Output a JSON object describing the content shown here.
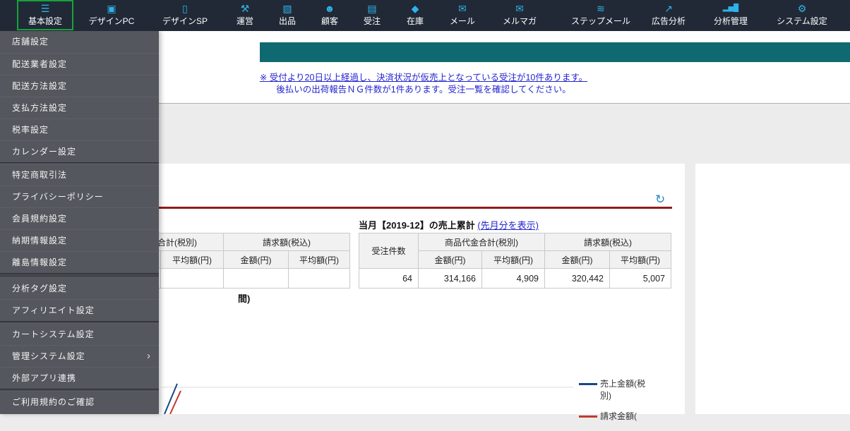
{
  "colors": {
    "nav_bg": "#212937",
    "nav_icon": "#2fb3e8",
    "menu_bg": "#54575d",
    "teal_band": "#0e6a70",
    "section_rule": "#8e1d1d",
    "link_blue": "#2424cf",
    "legend_revenue": "#1a4784",
    "legend_billing": "#c3392c",
    "highlight_green": "#17a23b"
  },
  "nav": {
    "items": [
      {
        "label": "基本設定",
        "icon": "sliders-icon",
        "glyph": "☰",
        "selected": true
      },
      {
        "label": "デザインPC",
        "icon": "monitor-icon",
        "glyph": "▣"
      },
      {
        "label": "デザインSP",
        "icon": "smartphone-icon",
        "glyph": "▯"
      },
      {
        "label": "運営",
        "icon": "operations-icon",
        "glyph": "⚒"
      },
      {
        "label": "出品",
        "icon": "listing-icon",
        "glyph": "▧"
      },
      {
        "label": "顧客",
        "icon": "customer-icon",
        "glyph": "☻"
      },
      {
        "label": "受注",
        "icon": "orders-icon",
        "glyph": "▤"
      },
      {
        "label": "在庫",
        "icon": "inventory-icon",
        "glyph": "◆"
      },
      {
        "label": "メール",
        "icon": "mail-icon",
        "glyph": "✉"
      },
      {
        "label": "メルマガ",
        "icon": "newsletter-icon",
        "glyph": "✉"
      },
      {
        "label": "ステップメール",
        "icon": "step-mail-icon",
        "glyph": "≋"
      },
      {
        "label": "広告分析",
        "icon": "ad-analysis-icon",
        "glyph": "↗"
      },
      {
        "label": "分析管理",
        "icon": "analytics-icon",
        "glyph": "▂▅█"
      },
      {
        "label": "システム設定",
        "icon": "system-settings-icon",
        "glyph": "⚙"
      }
    ]
  },
  "menu": {
    "chevron": "›",
    "items": [
      "店舗設定",
      "配送業者設定",
      "配送方法設定",
      "支払方法設定",
      "税率設定",
      "カレンダー設定",
      "特定商取引法",
      "プライバシーポリシー",
      "会員規約設定",
      "納期情報設定",
      "離島情報設定",
      "分析タグ設定",
      "アフィリエイト設定",
      "カートシステム設定",
      "管理システム設定",
      "外部アプリ連携",
      "ご利用規約のご確認"
    ]
  },
  "notice": {
    "line1": "※ 受付より20日以上経過し、決済状況が仮売上となっている受注が10件あります。",
    "line2": "後払いの出荷報告ＮＧ件数が1件あります。受注一覧を確認してください。"
  },
  "sales": {
    "title": "当月【2019-12】の売上累計",
    "last_month_link": "(先月分を表示)",
    "table": {
      "col_orders": "受注件数",
      "col_product_total": "商品代金合計(税別)",
      "col_billed": "請求額(税込)",
      "sub_amount": "金額(円)",
      "sub_average": "平均額(円)",
      "row": {
        "orders": "64",
        "product_amount": "314,166",
        "product_avg": "4,909",
        "billed_amount": "320,442",
        "billed_avg": "5,007"
      }
    }
  },
  "section2": {
    "visible_title": "間)"
  },
  "legend": {
    "items": [
      {
        "label": "売上金額(税別)"
      },
      {
        "label": "請求金額("
      }
    ]
  },
  "icons": {
    "refresh": "↻"
  }
}
